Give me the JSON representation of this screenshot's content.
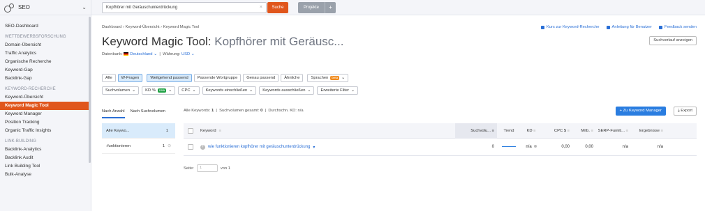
{
  "sidebar": {
    "title": "SEO",
    "items": [
      {
        "type": "item",
        "label": "SEO-Dashboard"
      },
      {
        "type": "section",
        "label": "WETTBEWERBSFORSCHUNG"
      },
      {
        "type": "item",
        "label": "Domain-Übersicht"
      },
      {
        "type": "item",
        "label": "Traffic Analytics"
      },
      {
        "type": "item",
        "label": "Organische Recherche"
      },
      {
        "type": "item",
        "label": "Keyword-Gap"
      },
      {
        "type": "item",
        "label": "Backlink-Gap"
      },
      {
        "type": "section",
        "label": "KEYWORD-RECHERCHE"
      },
      {
        "type": "item",
        "label": "Keyword-Übersicht"
      },
      {
        "type": "item",
        "label": "Keyword Magic Tool",
        "active": true
      },
      {
        "type": "item",
        "label": "Keyword Manager"
      },
      {
        "type": "item",
        "label": "Position Tracking"
      },
      {
        "type": "item",
        "label": "Organic Traffic Insights"
      },
      {
        "type": "section",
        "label": "LINK-BUILDING"
      },
      {
        "type": "item",
        "label": "Backlink-Analytics"
      },
      {
        "type": "item",
        "label": "Backlink Audit"
      },
      {
        "type": "item",
        "label": "Link Building Tool"
      },
      {
        "type": "item",
        "label": "Bulk-Analyse"
      }
    ]
  },
  "topbar": {
    "search_value": "Kopfhörer mit Geräuschunterdrückung",
    "search_button": "Suche",
    "projects_button": "Projekte",
    "projects_plus": "+"
  },
  "header": {
    "breadcrumb": "Dashboard  ›  Keyword-Übersicht  ›  Keyword Magic Tool",
    "links": [
      "Kurs zur Keyword-Recherche",
      "Anleitung für Benutzer",
      "Feedback senden"
    ],
    "title_tool": "Keyword Magic Tool:",
    "title_query": "Kopfhörer mit Geräusc...",
    "db_label": "Datenbank:",
    "db_value": "Deutschland",
    "currency_label": "Währung:",
    "currency_value": "USD",
    "history_button": "Suchverlauf anzeigen"
  },
  "filters": {
    "row1": [
      {
        "label": "Alle",
        "selected": false
      },
      {
        "label": "W-Fragen",
        "selected": true
      },
      {
        "label": "Weitgehend passend",
        "selected": true,
        "gap": true
      },
      {
        "label": "Passende Wortgruppe",
        "selected": false
      },
      {
        "label": "Genau passend",
        "selected": false
      },
      {
        "label": "Ähnliche",
        "selected": false
      },
      {
        "label": "Sprachen",
        "badge": "beta",
        "dropdown": true,
        "gap": true
      }
    ],
    "row2": [
      {
        "label": "Suchvolumen",
        "dropdown": true
      },
      {
        "label": "KD %",
        "badge": "new",
        "dropdown": true
      },
      {
        "label": "CPC",
        "dropdown": true
      },
      {
        "label": "Keywords einschließen",
        "dropdown": true
      },
      {
        "label": "Keywords ausschließen",
        "dropdown": true
      },
      {
        "label": "Erweiterte Filter",
        "dropdown": true
      }
    ]
  },
  "groups_tabs": [
    "Nach Anzahl",
    "Nach Suchvolumen"
  ],
  "groups": [
    {
      "label": "Alle Keywo...",
      "count": "1",
      "selected": true
    },
    {
      "label": "funktionieren",
      "count": "1",
      "selected": false
    }
  ],
  "summary": {
    "all_keywords_label": "Alle Keywords:",
    "all_keywords_value": "1",
    "volume_label": "Suchvolumen gesamt:",
    "volume_value": "0",
    "kd_label": "Durchschn. KD:",
    "kd_value": "n/a"
  },
  "actions": {
    "keyword_manager": "+  Zu Keyword Manager",
    "export": "Export"
  },
  "table": {
    "headers": {
      "keyword": "Keyword",
      "volume": "Suchvolu...",
      "trend": "Trend",
      "kd": "KD",
      "cpc": "CPC $",
      "mitb": "Mitb.",
      "serp": "SERP-Funkti...",
      "results": "Ergebnisse"
    },
    "rows": [
      {
        "keyword": "wie funktionieren kopfhörer mit geräuschunterdrückung",
        "volume": "0",
        "kd": "n/a",
        "cpc": "0,00",
        "mitb": "0,00",
        "serp": "n/a",
        "results": "n/a"
      }
    ]
  },
  "pager": {
    "label": "Seite:",
    "value": "1",
    "of": "von 1"
  }
}
